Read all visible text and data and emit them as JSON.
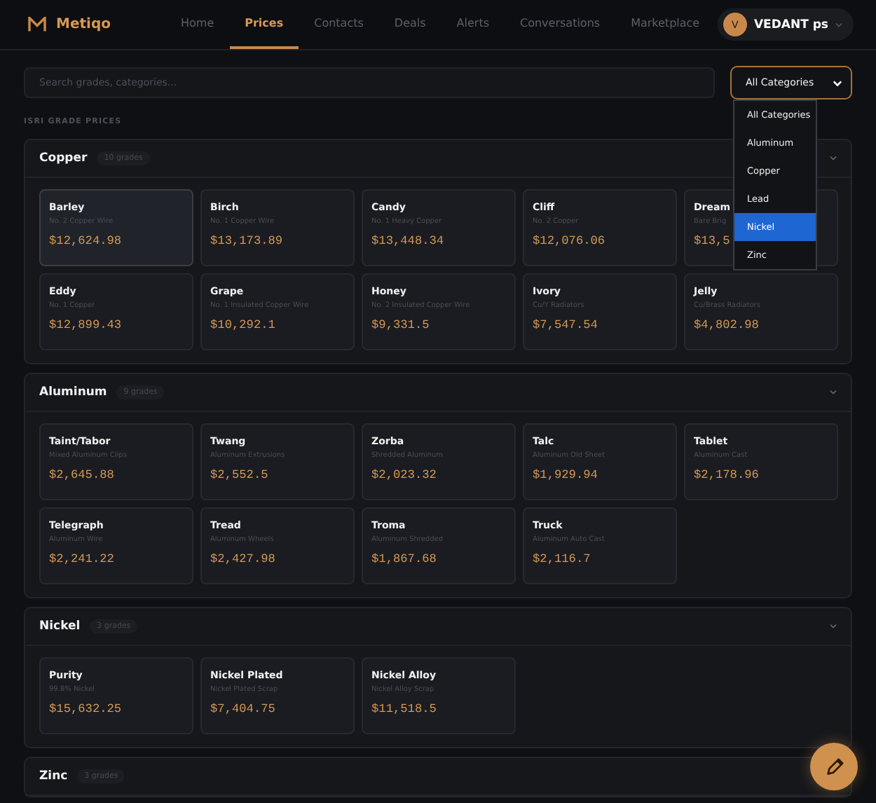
{
  "brand": {
    "name": "Metiqo"
  },
  "nav": [
    {
      "label": "Home",
      "selected": false
    },
    {
      "label": "Prices",
      "selected": true
    },
    {
      "label": "Contacts",
      "selected": false
    },
    {
      "label": "Deals",
      "selected": false
    },
    {
      "label": "Alerts",
      "selected": false
    },
    {
      "label": "Conversations",
      "selected": false
    },
    {
      "label": "Marketplace",
      "selected": false
    }
  ],
  "user": {
    "initial": "V",
    "name": "VEDANT ps"
  },
  "search": {
    "placeholder": "Search grades, categories..."
  },
  "category_select": {
    "value": "All Categories",
    "open": true,
    "options": [
      {
        "label": "All Categories",
        "highlighted": false
      },
      {
        "label": "Aluminum",
        "highlighted": false
      },
      {
        "label": "Copper",
        "highlighted": false
      },
      {
        "label": "Lead",
        "highlighted": false
      },
      {
        "label": "Nickel",
        "highlighted": true
      },
      {
        "label": "Zinc",
        "highlighted": false
      }
    ]
  },
  "section_label": "ISRI GRADE PRICES",
  "categories": [
    {
      "name": "Copper",
      "count": "10 grades",
      "expanded": true,
      "grades": [
        {
          "name": "Barley",
          "description": "No. 2 Copper Wire",
          "price": "$12,624.98",
          "hovered": true
        },
        {
          "name": "Birch",
          "description": "No. 1 Copper Wire",
          "price": "$13,173.89",
          "hovered": false
        },
        {
          "name": "Candy",
          "description": "No. 1 Heavy Copper",
          "price": "$13,448.34",
          "hovered": false
        },
        {
          "name": "Cliff",
          "description": "No. 2 Copper",
          "price": "$12,076.06",
          "hovered": false
        },
        {
          "name": "Dream",
          "description": "Bare Brig",
          "price": "$13,5",
          "hovered": false
        },
        {
          "name": "Eddy",
          "description": "No. 1 Copper",
          "price": "$12,899.43",
          "hovered": false
        },
        {
          "name": "Grape",
          "description": "No. 1 Insulated Copper Wire",
          "price": "$10,292.1",
          "hovered": false
        },
        {
          "name": "Honey",
          "description": "No. 2 Insulated Copper Wire",
          "price": "$9,331.5",
          "hovered": false
        },
        {
          "name": "Ivory",
          "description": "Cu/Y Radiators",
          "price": "$7,547.54",
          "hovered": false
        },
        {
          "name": "Jelly",
          "description": "Cu/Brass Radiators",
          "price": "$4,802.98",
          "hovered": false
        }
      ]
    },
    {
      "name": "Aluminum",
      "count": "9 grades",
      "expanded": true,
      "grades": [
        {
          "name": "Taint/Tabor",
          "description": "Mixed Aluminum Clips",
          "price": "$2,645.88",
          "hovered": false
        },
        {
          "name": "Twang",
          "description": "Aluminum Extrusions",
          "price": "$2,552.5",
          "hovered": false
        },
        {
          "name": "Zorba",
          "description": "Shredded Aluminum",
          "price": "$2,023.32",
          "hovered": false
        },
        {
          "name": "Talc",
          "description": "Aluminum Old Sheet",
          "price": "$1,929.94",
          "hovered": false
        },
        {
          "name": "Tablet",
          "description": "Aluminum Cast",
          "price": "$2,178.96",
          "hovered": false
        },
        {
          "name": "Telegraph",
          "description": "Aluminum Wire",
          "price": "$2,241.22",
          "hovered": false
        },
        {
          "name": "Tread",
          "description": "Aluminum Wheels",
          "price": "$2,427.98",
          "hovered": false
        },
        {
          "name": "Troma",
          "description": "Aluminum Shredded",
          "price": "$1,867.68",
          "hovered": false
        },
        {
          "name": "Truck",
          "description": "Aluminum Auto Cast",
          "price": "$2,116.7",
          "hovered": false
        }
      ]
    },
    {
      "name": "Nickel",
      "count": "3 grades",
      "expanded": true,
      "grades": [
        {
          "name": "Purity",
          "description": "99.8% Nickel",
          "price": "$15,632.25",
          "hovered": false
        },
        {
          "name": "Nickel Plated",
          "description": "Nickel Plated Scrap",
          "price": "$7,404.75",
          "hovered": false
        },
        {
          "name": "Nickel Alloy",
          "description": "Nickel Alloy Scrap",
          "price": "$11,518.5",
          "hovered": false
        }
      ]
    },
    {
      "name": "Zinc",
      "count": "3 grades",
      "expanded": true
    }
  ]
}
